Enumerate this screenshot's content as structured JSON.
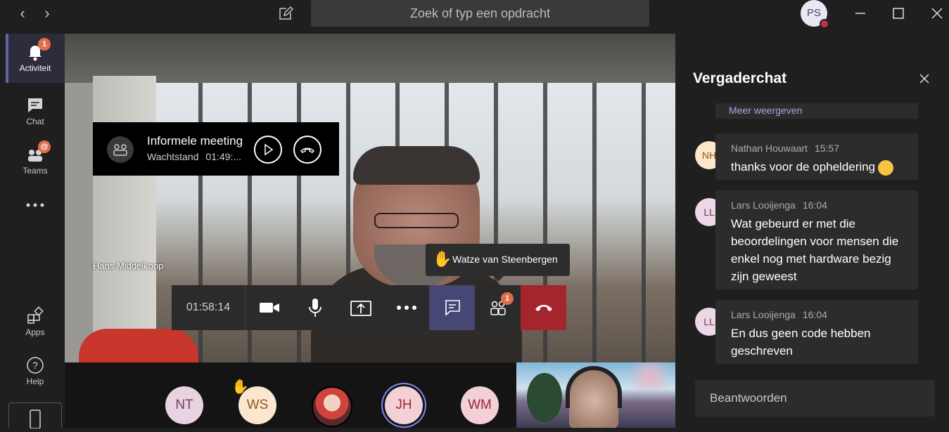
{
  "titlebar": {
    "search_placeholder": "Zoek of typ een opdracht",
    "user_initials": "PS"
  },
  "rail": {
    "items": [
      {
        "label": "Activiteit",
        "badge": "1"
      },
      {
        "label": "Chat"
      },
      {
        "label": "Teams"
      },
      {
        "label": "Apps"
      },
      {
        "label": "Help"
      }
    ]
  },
  "meeting_card": {
    "title": "Informele meeting",
    "status": "Wachtstand",
    "elapsed": "01:49:..."
  },
  "stage": {
    "speaker_name": "Hans Middelkoop",
    "raised_hand_name": "Watze van Steenbergen"
  },
  "controls": {
    "timer": "01:58:14",
    "participants_badge": "1"
  },
  "gallery": {
    "participants": [
      "NT",
      "WS",
      "JH",
      "WM"
    ]
  },
  "chat": {
    "title": "Vergaderchat",
    "more_link": "Meer weergeven",
    "messages": [
      {
        "initials": "NH",
        "author": "Nathan Houwaart",
        "time": "15:57",
        "text": "thanks voor de opheldering"
      },
      {
        "initials": "LL",
        "author": "Lars Looijenga",
        "time": "16:04",
        "text": "Wat gebeurd er met die beoordelingen voor mensen die enkel nog met hardware bezig zijn geweest"
      },
      {
        "initials": "LL",
        "author": "Lars Looijenga",
        "time": "16:04",
        "text": "En dus geen code hebben geschreven"
      }
    ],
    "reply_placeholder": "Beantwoorden"
  },
  "colors": {
    "accent": "#6264a7",
    "hangup": "#a4262c",
    "status_busy": "#c4314b",
    "badge": "#e26d4a"
  }
}
